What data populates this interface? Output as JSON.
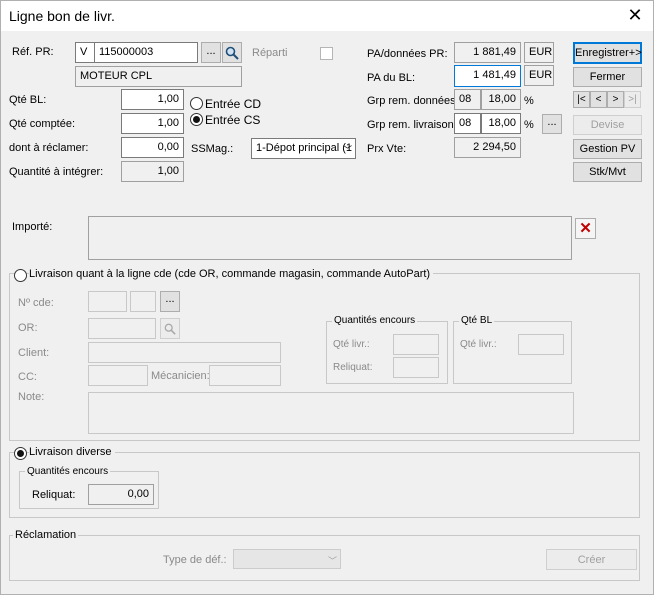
{
  "window": {
    "title": "Ligne bon de livr."
  },
  "ref_pr": {
    "label": "Réf. PR:",
    "prefix": "V",
    "code": "115000003",
    "description": "MOTEUR CPL",
    "browse": "..."
  },
  "reparti": {
    "label": "Réparti"
  },
  "qty": {
    "qte_bl_label": "Qté BL:",
    "qte_bl": "1,00",
    "qte_comptee_label": "Qté comptée:",
    "qte_comptee": "1,00",
    "a_reclamer_label": "dont à réclamer:",
    "a_reclamer": "0,00",
    "a_integrer_label": "Quantité à intégrer:",
    "a_integrer": "1,00"
  },
  "entree": {
    "cd": "Entrée CD",
    "cs": "Entrée CS"
  },
  "ssmag": {
    "label": "SSMag.:",
    "value": "1-Dépot principal (1"
  },
  "pricing": {
    "pa_pr_label": "PA/données PR:",
    "pa_pr": "1 881,49",
    "pa_pr_cur": "EUR",
    "pa_bl_label": "PA du BL:",
    "pa_bl": "1 481,49",
    "pa_bl_cur": "EUR",
    "grp_donnees_label": "Grp rem. données",
    "grp_donnees_code": "08",
    "grp_donnees_val": "18,00",
    "pct1": "%",
    "grp_livraison_label": "Grp rem. livraison:",
    "grp_livraison_code": "08",
    "grp_livraison_val": "18,00",
    "pct2": "%",
    "prx_vte_label": "Prx Vte:",
    "prx_vte": "2 294,50",
    "grp_browse": "..."
  },
  "buttons": {
    "enregistrer": "Enregistrer+>",
    "fermer": "Fermer",
    "devise": "Devise",
    "gestion_pv": "Gestion PV",
    "stk_mvt": "Stk/Mvt"
  },
  "nav": {
    "first": "|<",
    "prev": "<",
    "next": ">",
    "last": ">|"
  },
  "importe": {
    "label": "Importé:"
  },
  "livraison_cde": {
    "label": "Livraison quant à la ligne cde (cde OR, commande magasin, commande AutoPart)",
    "no_cde": "Nº cde:",
    "or": "OR:",
    "client": "Client:",
    "cc": "CC:",
    "mecanicien": "Mécanicien:",
    "note": "Note:",
    "browse": "...",
    "qte_encours_title": "Quantités encours",
    "qte_livr": "Qté livr.:",
    "reliquat": "Reliquat:",
    "qte_bl_title": "Qté BL",
    "qte_bl_livr": "Qté livr.:"
  },
  "livraison_diverse": {
    "label": "Livraison diverse",
    "encours_title": "Quantités encours",
    "reliquat_label": "Reliquat:",
    "reliquat": "0,00"
  },
  "reclamation": {
    "title": "Réclamation",
    "type_label": "Type de déf.:",
    "creer": "Créer"
  }
}
